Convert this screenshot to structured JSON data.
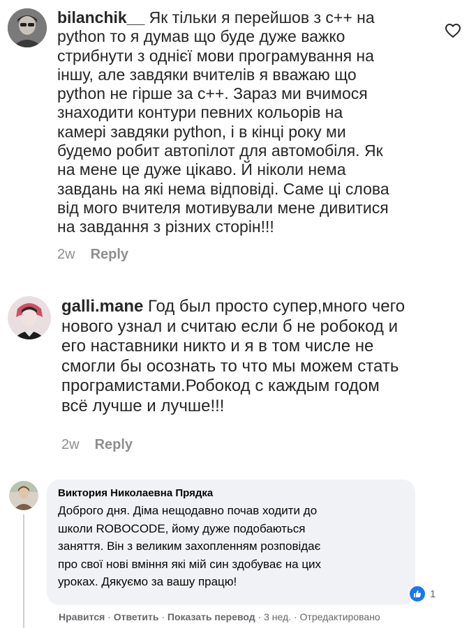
{
  "comments": [
    {
      "username": "bilanchik__",
      "text": "Як тільки я перейшов з с++ на\npython то я думав що буде дуже важко\nстрибнути з однієї мови програмування на\nіншу, але завдяки вчителів я вважаю що\npython не гірше за с++. Зараз ми вчимося\nзнаходити контури певних кольорів на\nкамері завдяки python, і в кінці року ми\nбудемо робит автопілот для автомобіля. Як\nна мене це дуже цікаво. Й ніколи нема\nзавдань на які нема відповіді. Саме ці слова\nвід мого вчителя мотивували мене дивитися\nна завдання з різних сторін!!!",
      "time": "2w",
      "reply_label": "Reply",
      "like_icon": "heart-outline-icon"
    },
    {
      "username": "galli.mane",
      "text": "Год был просто супер,много чего\nнового узнал и считаю если б не робокод и\nего наставники никто и я в том числе не\nсмогли бы осознать то что мы можем стать\nпрограмистами.Робокод с каждым годом\nвсё лучше и лучше!!!",
      "time": "2w",
      "reply_label": "Reply"
    }
  ],
  "fb_comment": {
    "name": "Виктория Николаевна Прядка",
    "text": "Доброго дня. Діма нещодавно почав ходити до\nшколи ROBOCODE, йому дуже подобаються\nзаняття. Він з великим захопленням розповідає\nпро свої нові вміння які мій син здобуває на цих\nуроках. Дякуємо за вашу працю!",
    "reaction_count": "1",
    "actions": {
      "like": "Нравится",
      "reply": "Ответить",
      "translate": "Показать перевод",
      "time": "3 нед.",
      "edited": "Отредактировано",
      "sep": " · "
    }
  },
  "colors": {
    "muted": "#8e8e8e",
    "text": "#262626",
    "fb_bubble": "#f0f2f5",
    "fb_like_blue": "#1877f2"
  }
}
